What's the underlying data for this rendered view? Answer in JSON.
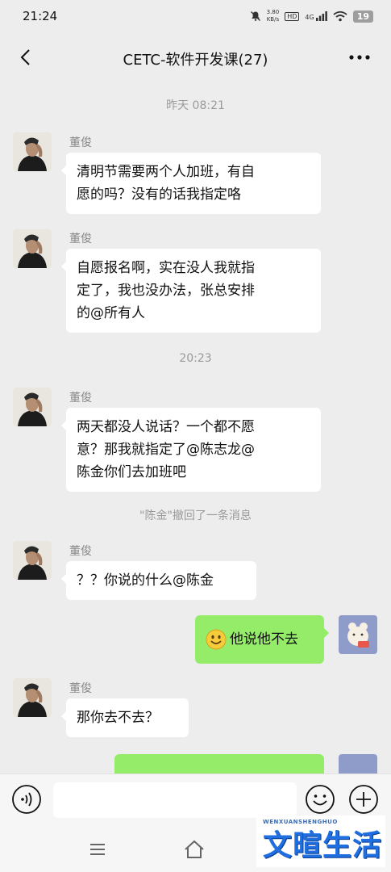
{
  "status_bar": {
    "time": "21:24",
    "net_speed_value": "3.80",
    "net_speed_unit": "KB/s",
    "hd": "HD",
    "signal": "4G",
    "battery": "19"
  },
  "header": {
    "title": "CETC-软件开发课(27)",
    "back_icon": "chevron-left-icon",
    "more_icon": "ellipsis-icon"
  },
  "messages": [
    {
      "kind": "time",
      "text": "昨天 08:21"
    },
    {
      "kind": "in",
      "sender": "董俊",
      "lines": [
        "清明节需要两个人加班，有自",
        "愿的吗？没有的话我指定咯"
      ]
    },
    {
      "kind": "in",
      "sender": "董俊",
      "lines": [
        "自愿报名啊，实在没人我就指",
        "定了，我也没办法，张总安排",
        "的@所有人"
      ]
    },
    {
      "kind": "time",
      "text": "20:23"
    },
    {
      "kind": "in",
      "sender": "董俊",
      "lines": [
        "两天都没人说话？一个都不愿",
        "意？那我就指定了@陈志龙@",
        "陈金你们去加班吧"
      ]
    },
    {
      "kind": "recall",
      "text": "\"陈金\"撤回了一条消息"
    },
    {
      "kind": "in",
      "sender": "董俊",
      "lines": [
        "？？你说的什么@陈金"
      ]
    },
    {
      "kind": "out",
      "text": "他说他不去",
      "emoji": "smiley-emoji-icon"
    },
    {
      "kind": "in",
      "sender": "董俊",
      "lines": [
        "那你去不去？"
      ]
    }
  ],
  "input_bar": {
    "placeholder": "",
    "voice_icon": "voice-icon",
    "emoji_icon": "emoji-face-icon",
    "plus_icon": "plus-circle-icon"
  },
  "system_nav": {
    "menu_icon": "menu-icon",
    "home_icon": "home-icon"
  },
  "watermark": {
    "small": "WENXUANSHENGHUO",
    "big": "文暄生活"
  },
  "colors": {
    "background": "#ededed",
    "outgoing_bubble": "#95ec69",
    "incoming_bubble": "#ffffff",
    "meta_text": "#9a9a9a",
    "watermark": "#1f6fe0"
  }
}
